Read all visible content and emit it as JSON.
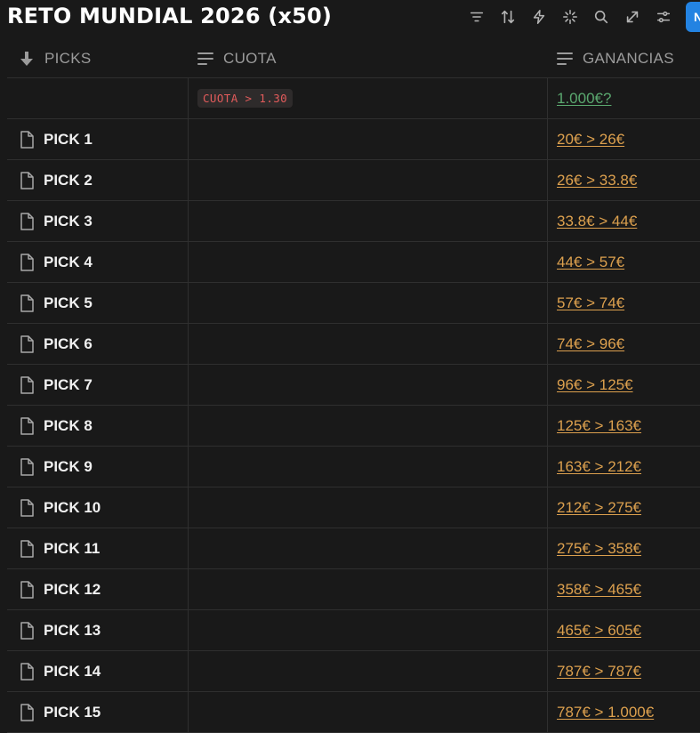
{
  "page": {
    "title": "RETO MUNDIAL 2026 (x50)"
  },
  "toolbar": {
    "icons": [
      "filter-icon",
      "sort-icon",
      "lightning-icon",
      "sparkle-icon",
      "search-icon",
      "expand-icon",
      "settings-sliders-icon"
    ],
    "new_label": "N"
  },
  "columns": {
    "picks": "PICKS",
    "cuota": "CUOTA",
    "ganancias": "GANANCIAS"
  },
  "summary": {
    "cuota": "CUOTA > 1.30",
    "ganancias": "1.000€?"
  },
  "rows": [
    {
      "name": "PICK 1",
      "ganancias": "20€ > 26€"
    },
    {
      "name": "PICK 2",
      "ganancias": "26€ > 33.8€"
    },
    {
      "name": "PICK 3",
      "ganancias": "33.8€ > 44€"
    },
    {
      "name": "PICK 4",
      "ganancias": "44€ > 57€"
    },
    {
      "name": "PICK 5",
      "ganancias": "57€ > 74€"
    },
    {
      "name": "PICK 6",
      "ganancias": "74€ > 96€"
    },
    {
      "name": "PICK 7",
      "ganancias": "96€ > 125€"
    },
    {
      "name": "PICK 8",
      "ganancias": "125€ > 163€"
    },
    {
      "name": "PICK 9",
      "ganancias": "163€ > 212€"
    },
    {
      "name": "PICK 10",
      "ganancias": "212€ > 275€"
    },
    {
      "name": "PICK 11",
      "ganancias": "275€ > 358€"
    },
    {
      "name": "PICK 12",
      "ganancias": "358€ > 465€"
    },
    {
      "name": "PICK 13",
      "ganancias": "465€ > 605€"
    },
    {
      "name": "PICK 14",
      "ganancias": "787€ > 787€"
    },
    {
      "name": "PICK 15",
      "ganancias": "787€ > 1.000€"
    }
  ],
  "colors": {
    "background": "#191919",
    "accent": "#2383e2",
    "gain_text": "#dca04e",
    "target_text": "#5aa86f",
    "cuota_badge_text": "#e25b5b"
  }
}
